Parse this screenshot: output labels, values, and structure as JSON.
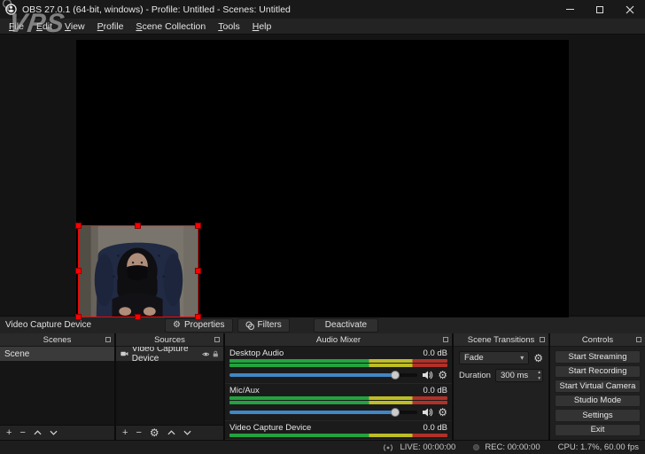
{
  "watermark": {
    "text": "VPS"
  },
  "window": {
    "title": "OBS 27.0.1 (64-bit, windows) - Profile: Untitled - Scenes: Untitled"
  },
  "menu": {
    "items": [
      "File",
      "Edit",
      "View",
      "Profile",
      "Scene Collection",
      "Tools",
      "Help"
    ]
  },
  "source_toolbar": {
    "source_name": "Video Capture Device",
    "properties": "Properties",
    "filters": "Filters",
    "deactivate": "Deactivate"
  },
  "docks": {
    "scenes": {
      "title": "Scenes",
      "items": [
        {
          "name": "Scene"
        }
      ]
    },
    "sources": {
      "title": "Sources",
      "items": [
        {
          "name": "Video Capture Device"
        }
      ]
    },
    "audio_mixer": {
      "title": "Audio Mixer",
      "channels": [
        {
          "name": "Desktop Audio",
          "volume": "0.0 dB"
        },
        {
          "name": "Mic/Aux",
          "volume": "0.0 dB"
        },
        {
          "name": "Video Capture Device",
          "volume": "0.0 dB"
        }
      ]
    },
    "scene_transitions": {
      "title": "Scene Transitions",
      "transition": "Fade",
      "duration_label": "Duration",
      "duration_value": "300 ms"
    },
    "controls": {
      "title": "Controls",
      "buttons": [
        "Start Streaming",
        "Start Recording",
        "Start Virtual Camera",
        "Studio Mode",
        "Settings",
        "Exit"
      ]
    }
  },
  "status_bar": {
    "live": "LIVE: 00:00:00",
    "rec": "REC: 00:00:00",
    "stats": "CPU: 1.7%, 60.00 fps"
  }
}
